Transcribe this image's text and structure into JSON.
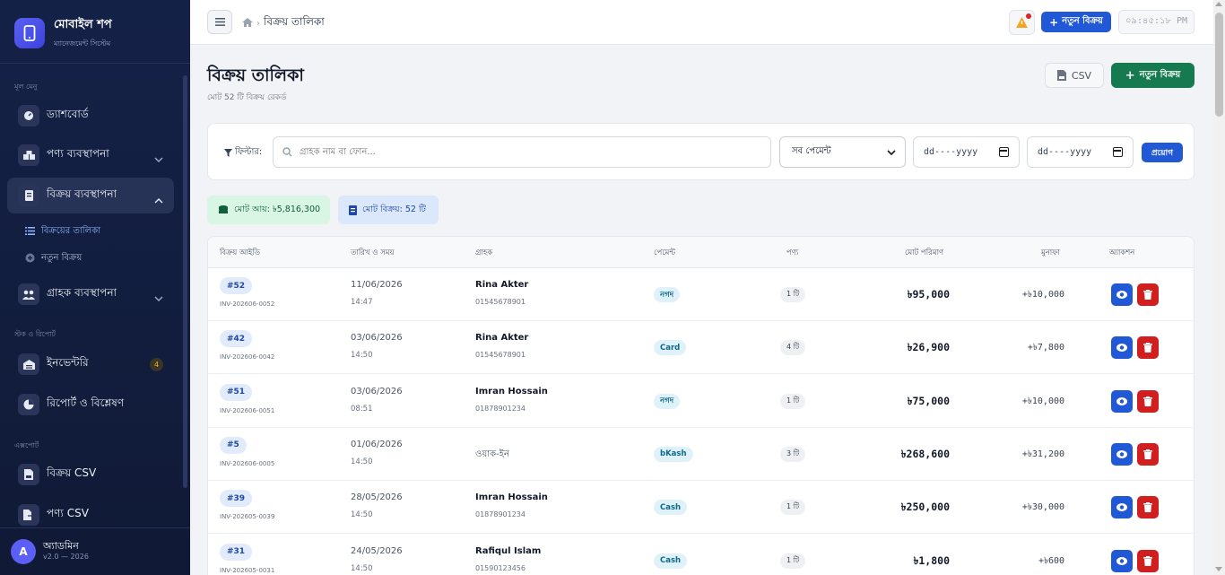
{
  "brand": {
    "name": "মোবাইল শপ",
    "subtitle": "ম্যানেজমেন্ট সিস্টেম"
  },
  "sidebar": {
    "section_main": "মূল মেনু",
    "dashboard": "ড্যাশবোর্ড",
    "products": "পণ্য ব্যবস্থাপনা",
    "sales": "বিক্রয় ব্যবস্থাপনা",
    "sales_list": "বিক্রয়ের তালিকা",
    "new_sale": "নতুন বিক্রয়",
    "customers": "গ্রাহক ব্যবস্থাপনা",
    "section_stock": "স্টক ও রিপোর্ট",
    "inventory": "ইনভেন্টরি",
    "inventory_badge": "4",
    "reports": "রিপোর্ট ও বিশ্লেষণ",
    "section_export": "এক্সপোর্ট",
    "sales_csv": "বিক্রয় CSV",
    "product_csv": "পণ্য CSV"
  },
  "user": {
    "initial": "A",
    "name": "অ্যাডমিন",
    "version": "v2.0 — 2026"
  },
  "header": {
    "breadcrumb": "বিক্রয় তালিকা",
    "new_sale": "নতুন বিক্রয়",
    "clock": "০৯:৪৫:১৮ PM"
  },
  "page": {
    "title": "বিক্রয় তালিকা",
    "subtitle": "মোট 52 টি বিক্রয় রেকর্ড",
    "csv": "CSV",
    "new_sale": "নতুন বিক্রয়"
  },
  "filter": {
    "label": "ফিল্টার:",
    "search_placeholder": "গ্রাহক নাম বা ফোন...",
    "payment_selected": "সব পেমেন্ট",
    "date_placeholder": "dd----yyyy",
    "apply": "প্রয়োগ"
  },
  "stats": {
    "revenue": "মোট আয়: ৳5,816,300",
    "count": "মোট বিক্রয়: 52 টি"
  },
  "table": {
    "headers": [
      "বিক্রয় আইডি",
      "তারিখ ও সময়",
      "গ্রাহক",
      "পেমেন্ট",
      "পণ্য",
      "মোট পরিমাণ",
      "মুনাফা",
      "অ্যাকশন"
    ],
    "rows": [
      {
        "id": "#52",
        "inv": "INV-202606-0052",
        "date": "11/06/2026",
        "time": "14:47",
        "customer": "Rina Akter",
        "phone": "01545678901",
        "payment": "নগদ",
        "qty": "1 টি",
        "total": "৳95,000",
        "profit": "+৳10,000"
      },
      {
        "id": "#42",
        "inv": "INV-202606-0042",
        "date": "03/06/2026",
        "time": "14:50",
        "customer": "Rina Akter",
        "phone": "01545678901",
        "payment": "Card",
        "qty": "4 টি",
        "total": "৳26,900",
        "profit": "+৳7,800"
      },
      {
        "id": "#51",
        "inv": "INV-202606-0051",
        "date": "03/06/2026",
        "time": "08:51",
        "customer": "Imran Hossain",
        "phone": "01878901234",
        "payment": "নগদ",
        "qty": "1 টি",
        "total": "৳75,000",
        "profit": "+৳10,000"
      },
      {
        "id": "#5",
        "inv": "INV-202606-0005",
        "date": "01/06/2026",
        "time": "14:50",
        "customer": "ওয়াক-ইন",
        "phone": "",
        "payment": "bKash",
        "qty": "3 টি",
        "total": "৳268,600",
        "profit": "+৳31,200"
      },
      {
        "id": "#39",
        "inv": "INV-202605-0039",
        "date": "28/05/2026",
        "time": "14:50",
        "customer": "Imran Hossain",
        "phone": "01878901234",
        "payment": "Cash",
        "qty": "1 টি",
        "total": "৳250,000",
        "profit": "+৳30,000"
      },
      {
        "id": "#31",
        "inv": "INV-202605-0031",
        "date": "24/05/2026",
        "time": "14:50",
        "customer": "Rafiqul Islam",
        "phone": "01590123456",
        "payment": "Cash",
        "qty": "1 টি",
        "total": "৳1,800",
        "profit": "+৳600"
      }
    ]
  },
  "colors": {
    "sidebar": "#142147",
    "primary": "#2158d6",
    "success": "#157a4f",
    "danger": "#d11f1f"
  }
}
